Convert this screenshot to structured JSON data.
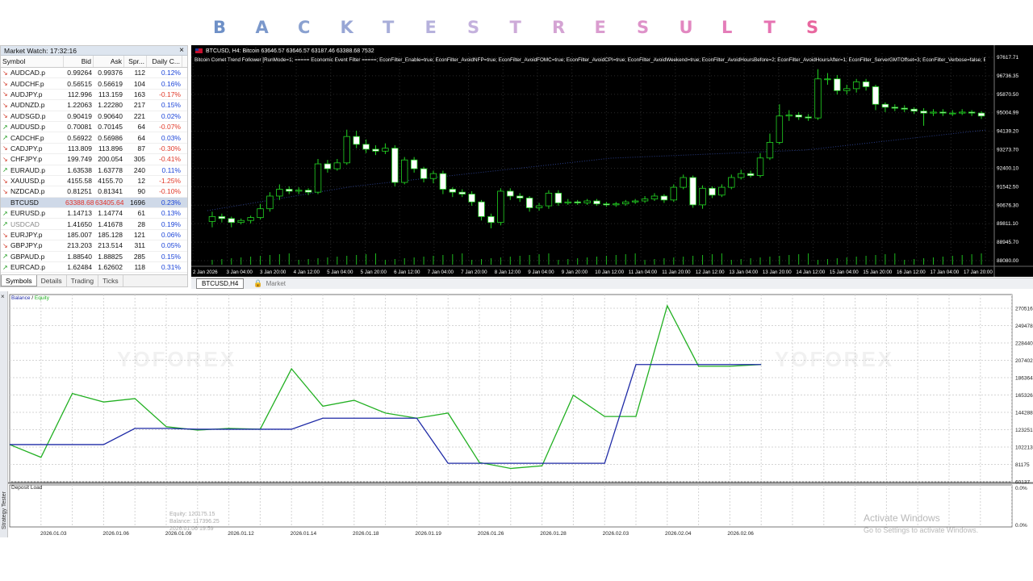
{
  "title": {
    "letters": [
      {
        "char": "B",
        "color": "#6e90c7"
      },
      {
        "char": "A",
        "color": "#7b98cb"
      },
      {
        "char": "C",
        "color": "#8aa1d0"
      },
      {
        "char": "K",
        "color": "#98a6d5"
      },
      {
        "char": "T",
        "color": "#a8aed9"
      },
      {
        "char": "E",
        "color": "#b6b1dc"
      },
      {
        "char": "S",
        "color": "#c4b1dd"
      },
      {
        "char": "T",
        "color": "#cdaad8"
      },
      {
        "char": "R",
        "color": "#d4a3d3"
      },
      {
        "char": "E",
        "color": "#da9ccf"
      },
      {
        "char": "S",
        "color": "#de92c9"
      },
      {
        "char": "U",
        "color": "#e287c0"
      },
      {
        "char": "L",
        "color": "#e47db9"
      },
      {
        "char": "T",
        "color": "#e673b2"
      },
      {
        "char": "S",
        "color": "#e8679f"
      }
    ]
  },
  "market_watch": {
    "header": "Market Watch: 17:32:16",
    "close": "×",
    "columns": [
      "Symbol",
      "Bid",
      "Ask",
      "Spr...",
      "Daily C..."
    ],
    "rows": [
      {
        "symbol": "AUDCAD.p",
        "dir": "down",
        "bid": "0.99264",
        "ask": "0.99376",
        "spread": "112",
        "change": "0.12%",
        "neg": false
      },
      {
        "symbol": "AUDCHF.p",
        "dir": "down",
        "bid": "0.56515",
        "ask": "0.56619",
        "spread": "104",
        "change": "0.16%",
        "neg": false
      },
      {
        "symbol": "AUDJPY.p",
        "dir": "down",
        "bid": "112.996",
        "ask": "113.159",
        "spread": "163",
        "change": "-0.17%",
        "neg": true
      },
      {
        "symbol": "AUDNZD.p",
        "dir": "down",
        "bid": "1.22063",
        "ask": "1.22280",
        "spread": "217",
        "change": "0.15%",
        "neg": false
      },
      {
        "symbol": "AUDSGD.p",
        "dir": "down",
        "bid": "0.90419",
        "ask": "0.90640",
        "spread": "221",
        "change": "0.02%",
        "neg": false
      },
      {
        "symbol": "AUDUSD.p",
        "dir": "up",
        "bid": "0.70081",
        "ask": "0.70145",
        "spread": "64",
        "change": "-0.07%",
        "neg": true
      },
      {
        "symbol": "CADCHF.p",
        "dir": "up",
        "bid": "0.56922",
        "ask": "0.56986",
        "spread": "64",
        "change": "0.03%",
        "neg": false
      },
      {
        "symbol": "CADJPY.p",
        "dir": "down",
        "bid": "113.809",
        "ask": "113.896",
        "spread": "87",
        "change": "-0.30%",
        "neg": true
      },
      {
        "symbol": "CHFJPY.p",
        "dir": "down",
        "bid": "199.749",
        "ask": "200.054",
        "spread": "305",
        "change": "-0.41%",
        "neg": true
      },
      {
        "symbol": "EURAUD.p",
        "dir": "up",
        "bid": "1.63538",
        "ask": "1.63778",
        "spread": "240",
        "change": "0.11%",
        "neg": false
      },
      {
        "symbol": "XAUUSD.p",
        "dir": "down",
        "bid": "4155.58",
        "ask": "4155.70",
        "spread": "12",
        "change": "-1.25%",
        "neg": true
      },
      {
        "symbol": "NZDCAD.p",
        "dir": "down",
        "bid": "0.81251",
        "ask": "0.81341",
        "spread": "90",
        "change": "-0.10%",
        "neg": true
      },
      {
        "symbol": "BTCUSD",
        "dir": "none",
        "bid": "63388.68",
        "ask": "63405.64",
        "spread": "1696",
        "change": "0.23%",
        "neg": false,
        "selected": true
      },
      {
        "symbol": "EURUSD.p",
        "dir": "up",
        "bid": "1.14713",
        "ask": "1.14774",
        "spread": "61",
        "change": "0.13%",
        "neg": false
      },
      {
        "symbol": "USDCAD",
        "dir": "up",
        "bid": "1.41650",
        "ask": "1.41678",
        "spread": "28",
        "change": "0.19%",
        "neg": false,
        "grey": true
      },
      {
        "symbol": "EURJPY.p",
        "dir": "down",
        "bid": "185.007",
        "ask": "185.128",
        "spread": "121",
        "change": "0.06%",
        "neg": false
      },
      {
        "symbol": "GBPJPY.p",
        "dir": "down",
        "bid": "213.203",
        "ask": "213.514",
        "spread": "311",
        "change": "0.05%",
        "neg": false
      },
      {
        "symbol": "GBPAUD.p",
        "dir": "up",
        "bid": "1.88540",
        "ask": "1.88825",
        "spread": "285",
        "change": "0.15%",
        "neg": false
      },
      {
        "symbol": "EURCAD.p",
        "dir": "up",
        "bid": "1.62484",
        "ask": "1.62602",
        "spread": "118",
        "change": "0.31%",
        "neg": false
      }
    ],
    "tabs": [
      "Symbols",
      "Details",
      "Trading",
      "Ticks"
    ]
  },
  "price_chart": {
    "header": "BTCUSD, H4:  Bitcoin  63646.57 63646.57 63187.46 63388.68  7532",
    "params": "Bitcoin Comet Trend Follower [RunMode=1; ===== Economic Event Filter =====; EconFilter_Enable=true; EconFilter_AvoidNFP=true; EconFilter_AvoidFOMC=true; EconFilter_AvoidCPI=true; EconFilter_AvoidWeekend=true; EconFilter_AvoidHoursBefore=2; EconFilter_AvoidHoursAfter=1; EconFilter_ServerGMTOffset=3; EconFilter_Verbose=false; EconFilter_",
    "price_labels": [
      "97617.71",
      "96736.35",
      "95870.50",
      "95004.99",
      "94139.20",
      "93273.70",
      "92400.10",
      "91542.50",
      "90676.30",
      "89811.10",
      "88945.70",
      "88080.00"
    ],
    "time_labels": [
      "2 Jan 2026",
      "3 Jan 04:00",
      "3 Jan 20:00",
      "4 Jan 12:00",
      "5 Jan 04:00",
      "5 Jan 20:00",
      "6 Jan 12:00",
      "7 Jan 04:00",
      "7 Jan 20:00",
      "8 Jan 12:00",
      "9 Jan 04:00",
      "9 Jan 20:00",
      "10 Jan 12:00",
      "11 Jan 04:00",
      "11 Jan 20:00",
      "12 Jan 12:00",
      "13 Jan 04:00",
      "13 Jan 20:00",
      "14 Jan 12:00",
      "15 Jan 04:00",
      "15 Jan 20:00",
      "16 Jan 12:00",
      "17 Jan 04:00",
      "17 Jan 20:00"
    ],
    "candles": [
      {
        "o": 89700,
        "c": 89950,
        "h": 90200,
        "l": 89400
      },
      {
        "o": 89950,
        "c": 89850,
        "h": 90100,
        "l": 89650
      },
      {
        "o": 89850,
        "c": 89650,
        "h": 89950,
        "l": 89400
      },
      {
        "o": 89650,
        "c": 89750,
        "h": 89850,
        "l": 89550
      },
      {
        "o": 89750,
        "c": 89900,
        "h": 90000,
        "l": 89600
      },
      {
        "o": 89900,
        "c": 90350,
        "h": 90600,
        "l": 89800
      },
      {
        "o": 90350,
        "c": 91000,
        "h": 91200,
        "l": 90200
      },
      {
        "o": 91000,
        "c": 91350,
        "h": 91600,
        "l": 90800
      },
      {
        "o": 91350,
        "c": 91250,
        "h": 91500,
        "l": 91100
      },
      {
        "o": 91250,
        "c": 91300,
        "h": 91450,
        "l": 91100
      },
      {
        "o": 91300,
        "c": 91200,
        "h": 91400,
        "l": 91050
      },
      {
        "o": 91200,
        "c": 92650,
        "h": 92900,
        "l": 91100
      },
      {
        "o": 92650,
        "c": 92400,
        "h": 92850,
        "l": 92200
      },
      {
        "o": 92400,
        "c": 92700,
        "h": 92900,
        "l": 92300
      },
      {
        "o": 92700,
        "c": 94050,
        "h": 94400,
        "l": 92600
      },
      {
        "o": 94050,
        "c": 93650,
        "h": 94350,
        "l": 93450
      },
      {
        "o": 93650,
        "c": 93400,
        "h": 93900,
        "l": 93200
      },
      {
        "o": 93400,
        "c": 93300,
        "h": 93600,
        "l": 93100
      },
      {
        "o": 93300,
        "c": 93450,
        "h": 93700,
        "l": 93150
      },
      {
        "o": 93450,
        "c": 91700,
        "h": 93600,
        "l": 91500
      },
      {
        "o": 91700,
        "c": 92850,
        "h": 93000,
        "l": 91600
      },
      {
        "o": 92850,
        "c": 92400,
        "h": 93000,
        "l": 92200
      },
      {
        "o": 92400,
        "c": 91900,
        "h": 92500,
        "l": 91700
      },
      {
        "o": 91900,
        "c": 92150,
        "h": 92300,
        "l": 91650
      },
      {
        "o": 92150,
        "c": 91350,
        "h": 92300,
        "l": 91100
      },
      {
        "o": 91350,
        "c": 91200,
        "h": 91450,
        "l": 90950
      },
      {
        "o": 91200,
        "c": 91100,
        "h": 91350,
        "l": 90950
      },
      {
        "o": 91100,
        "c": 90700,
        "h": 91250,
        "l": 90500
      },
      {
        "o": 90700,
        "c": 89950,
        "h": 90800,
        "l": 89750
      },
      {
        "o": 89950,
        "c": 89650,
        "h": 90100,
        "l": 89350
      },
      {
        "o": 89650,
        "c": 91250,
        "h": 91400,
        "l": 89500
      },
      {
        "o": 91250,
        "c": 91000,
        "h": 91400,
        "l": 90800
      },
      {
        "o": 91000,
        "c": 90900,
        "h": 91150,
        "l": 90700
      },
      {
        "o": 90900,
        "c": 90400,
        "h": 91000,
        "l": 90200
      },
      {
        "o": 90400,
        "c": 90500,
        "h": 90650,
        "l": 90250
      },
      {
        "o": 90500,
        "c": 91150,
        "h": 91300,
        "l": 90350
      },
      {
        "o": 91150,
        "c": 90650,
        "h": 91300,
        "l": 90500
      },
      {
        "o": 90650,
        "c": 90700,
        "h": 90850,
        "l": 90550
      },
      {
        "o": 90700,
        "c": 90650,
        "h": 90800,
        "l": 90550
      },
      {
        "o": 90650,
        "c": 90750,
        "h": 90850,
        "l": 90550
      },
      {
        "o": 90750,
        "c": 90600,
        "h": 90850,
        "l": 90500
      },
      {
        "o": 90600,
        "c": 90550,
        "h": 90700,
        "l": 90450
      },
      {
        "o": 90550,
        "c": 90600,
        "h": 90700,
        "l": 90450
      },
      {
        "o": 90600,
        "c": 90700,
        "h": 90800,
        "l": 90500
      },
      {
        "o": 90700,
        "c": 90750,
        "h": 90850,
        "l": 90600
      },
      {
        "o": 90750,
        "c": 90850,
        "h": 91000,
        "l": 90650
      },
      {
        "o": 90850,
        "c": 91000,
        "h": 91150,
        "l": 90750
      },
      {
        "o": 91000,
        "c": 90800,
        "h": 91100,
        "l": 90650
      },
      {
        "o": 90800,
        "c": 91450,
        "h": 91600,
        "l": 90700
      },
      {
        "o": 91450,
        "c": 91950,
        "h": 92100,
        "l": 91350
      },
      {
        "o": 91950,
        "c": 90550,
        "h": 92050,
        "l": 90400
      },
      {
        "o": 90550,
        "c": 91400,
        "h": 91550,
        "l": 90350
      },
      {
        "o": 91400,
        "c": 91050,
        "h": 91500,
        "l": 90900
      },
      {
        "o": 91050,
        "c": 91450,
        "h": 91600,
        "l": 90950
      },
      {
        "o": 91450,
        "c": 91950,
        "h": 92100,
        "l": 91350
      },
      {
        "o": 91950,
        "c": 92150,
        "h": 92350,
        "l": 91850
      },
      {
        "o": 92150,
        "c": 92050,
        "h": 92300,
        "l": 91950
      },
      {
        "o": 92050,
        "c": 92950,
        "h": 93200,
        "l": 91950
      },
      {
        "o": 92950,
        "c": 93750,
        "h": 94200,
        "l": 92850
      },
      {
        "o": 93750,
        "c": 95100,
        "h": 95700,
        "l": 93650
      },
      {
        "o": 95100,
        "c": 95150,
        "h": 95400,
        "l": 94850
      },
      {
        "o": 95150,
        "c": 95050,
        "h": 95300,
        "l": 94900
      },
      {
        "o": 95050,
        "c": 95000,
        "h": 95200,
        "l": 94850
      },
      {
        "o": 95000,
        "c": 97000,
        "h": 97500,
        "l": 94900
      },
      {
        "o": 97000,
        "c": 97000,
        "h": 97300,
        "l": 96700
      },
      {
        "o": 97000,
        "c": 96400,
        "h": 97200,
        "l": 96200
      },
      {
        "o": 96400,
        "c": 96500,
        "h": 96700,
        "l": 96200
      },
      {
        "o": 96500,
        "c": 96850,
        "h": 97000,
        "l": 96300
      },
      {
        "o": 96850,
        "c": 96600,
        "h": 97000,
        "l": 96400
      },
      {
        "o": 96600,
        "c": 95700,
        "h": 96700,
        "l": 95400
      },
      {
        "o": 95700,
        "c": 95550,
        "h": 95800,
        "l": 95300
      },
      {
        "o": 95550,
        "c": 95500,
        "h": 95700,
        "l": 95350
      },
      {
        "o": 95500,
        "c": 95450,
        "h": 95650,
        "l": 95300
      },
      {
        "o": 95450,
        "c": 95350,
        "h": 95550,
        "l": 95200
      },
      {
        "o": 95350,
        "c": 95250,
        "h": 95500,
        "l": 94600
      },
      {
        "o": 95250,
        "c": 95300,
        "h": 95450,
        "l": 95100
      },
      {
        "o": 95300,
        "c": 95250,
        "h": 95450,
        "l": 95100
      },
      {
        "o": 95250,
        "c": 95250,
        "h": 95400,
        "l": 95100
      },
      {
        "o": 95250,
        "c": 95300,
        "h": 95450,
        "l": 95150
      },
      {
        "o": 95300,
        "c": 95250,
        "h": 95400,
        "l": 95100
      },
      {
        "o": 95250,
        "c": 95100,
        "h": 95350,
        "l": 94950
      }
    ]
  },
  "chart_tabs": {
    "active": "BTCUSD,H4",
    "lock": "🔒",
    "market": "Market"
  },
  "tester": {
    "strip_label": "Strategy Tester",
    "close": "×",
    "legend_balance": "Balance",
    "legend_sep": " / ",
    "legend_equity": "Equity",
    "deposit_label": "Deposit Load",
    "y_labels": [
      "270516",
      "249478",
      "228440",
      "207402",
      "186364",
      "165326",
      "144288",
      "123251",
      "102213",
      "81175",
      "60137"
    ],
    "deposit_y_labels": [
      "0.0%",
      "0.0%"
    ],
    "x_labels": [
      "2026.01.03",
      "2026.01.06",
      "2026.01.09",
      "2026.01.12",
      "2026.01.14",
      "2026.01.18",
      "2026.01.19",
      "2026.01.26",
      "2026.01.28",
      "2026.02.03",
      "2026.02.04",
      "2026.02.06"
    ],
    "hover_lines": [
      "Equity: 120175.15",
      "Balance: 117396.25",
      "2026.01.06 19:59"
    ],
    "activate_title": "Activate Windows",
    "activate_sub": "Go to Settings to activate Windows.",
    "watermark": "YOFOREX"
  },
  "chart_data": {
    "type": "line",
    "title": "",
    "xlabel": "",
    "ylabel": "",
    "ylim": [
      60137,
      270516
    ],
    "x": [
      0,
      1,
      2,
      3,
      4,
      5,
      6,
      7,
      8,
      9,
      10,
      11,
      12,
      13,
      14,
      15,
      16,
      17,
      18,
      19,
      20,
      21,
      22,
      23,
      24
    ],
    "series": [
      {
        "name": "Balance",
        "color": "#1e2aa6",
        "values": [
          100000,
          100000,
          100000,
          100000,
          119000,
          119000,
          118000,
          118000,
          118000,
          118000,
          131000,
          131000,
          131000,
          131000,
          78000,
          78000,
          78000,
          78000,
          78000,
          78000,
          194000,
          194000,
          194000,
          194000,
          194000
        ]
      },
      {
        "name": "Equity",
        "color": "#22b022",
        "values": [
          100000,
          85000,
          160000,
          150000,
          154000,
          121000,
          117000,
          119000,
          118000,
          189000,
          145000,
          152000,
          137000,
          131000,
          137000,
          79000,
          72000,
          75000,
          158000,
          133000,
          133000,
          263000,
          192000,
          192000,
          194000
        ]
      }
    ]
  }
}
